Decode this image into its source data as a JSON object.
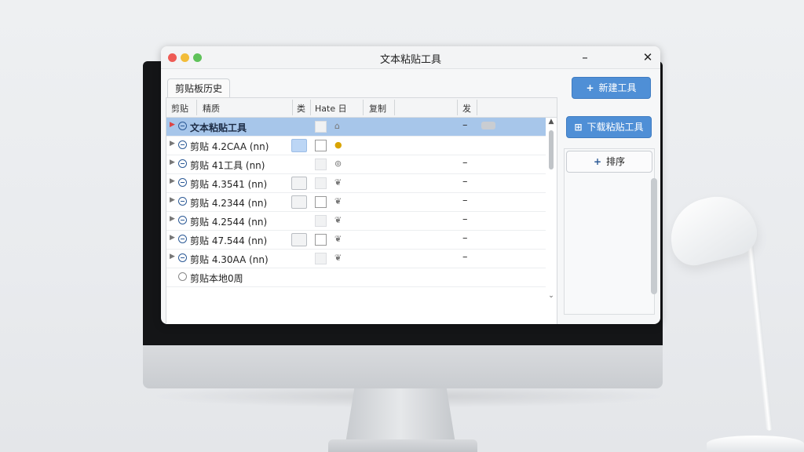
{
  "window": {
    "title": "文本粘贴工具",
    "minimize": "–",
    "close": "✕"
  },
  "tab": {
    "label": "剪贴板历史"
  },
  "columns": [
    "剪贴",
    "精质",
    "类",
    "Hate 日",
    "复制",
    "发"
  ],
  "rows": [
    {
      "label": "文本粘贴工具",
      "selected": true,
      "box1": "none",
      "checkbox": "ghost",
      "glyph": "⌂",
      "dash": "–",
      "pill": true
    },
    {
      "label": "剪贴 4.2CAA (nn)",
      "selected": false,
      "box1": "blue",
      "checkbox": "on",
      "glyph": "●",
      "dash": "",
      "pill": false
    },
    {
      "label": "剪贴 41工具 (nn)",
      "selected": false,
      "box1": "none",
      "checkbox": "ghost",
      "glyph": "⊚",
      "dash": "–",
      "pill": false
    },
    {
      "label": "剪贴 4.3541 (nn)",
      "selected": false,
      "box1": "grey",
      "checkbox": "ghost",
      "glyph": "❦",
      "dash": "–",
      "pill": false
    },
    {
      "label": "剪贴 4.2344 (nn)",
      "selected": false,
      "box1": "grey",
      "checkbox": "on",
      "glyph": "❦",
      "dash": "–",
      "pill": false
    },
    {
      "label": "剪贴 4.2544 (nn)",
      "selected": false,
      "box1": "none",
      "checkbox": "ghost",
      "glyph": "❦",
      "dash": "–",
      "pill": false
    },
    {
      "label": "剪贴 47.544 (nn)",
      "selected": false,
      "box1": "grey",
      "checkbox": "on",
      "glyph": "❦",
      "dash": "–",
      "pill": false
    },
    {
      "label": "剪贴 4.30AA (nn)",
      "selected": false,
      "box1": "none",
      "checkbox": "ghost",
      "glyph": "❦",
      "dash": "–",
      "pill": false
    },
    {
      "label": "剪贴本地0周",
      "selected": false,
      "box1": "none",
      "checkbox": "none",
      "glyph": "",
      "dash": "",
      "pill": false,
      "plain": true
    }
  ],
  "buttons": {
    "add": {
      "icon": "+",
      "label": "新建工具"
    },
    "paste": {
      "icon": "⊞",
      "label": "下载粘贴工具"
    },
    "sort": {
      "icon": "+",
      "label": "排序"
    }
  },
  "colors": {
    "accent": "#4f8fd6",
    "selection": "#a7c6ea"
  }
}
